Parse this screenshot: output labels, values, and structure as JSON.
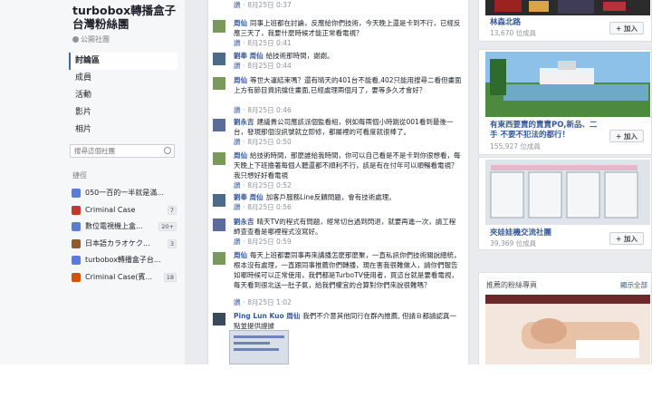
{
  "group": {
    "title": "turbobox轉播盒子台灣粉絲團",
    "type": "公開社團"
  },
  "nav": [
    "討論區",
    "成員",
    "活動",
    "影片",
    "相片"
  ],
  "search": {
    "placeholder": "搜尋這個社團"
  },
  "shortcuts": {
    "title": "捷徑",
    "items": [
      {
        "label": "050一百的一半就是滿...",
        "count": "",
        "color": "#5b7bd5"
      },
      {
        "label": "Criminal Case",
        "count": "7",
        "color": "#c0392b"
      },
      {
        "label": "數位電視機上盒...",
        "count": "20+",
        "color": "#5b7bd5"
      },
      {
        "label": "日本語カラオケク...",
        "count": "3",
        "color": "#8e5b2d"
      },
      {
        "label": "turbobox轉播盒子台...",
        "count": "",
        "color": "#5b7bd5"
      },
      {
        "label": "Criminal Case(賓...",
        "count": "18",
        "color": "#d35400"
      }
    ]
  },
  "comments": [
    {
      "name": "",
      "text": "",
      "time": "8月25日 0:37"
    },
    {
      "name": "周仙",
      "text": "同事上班都在討論，反應給你們技術，今天晚上還是卡到不行，已經反應三天了，我要什麼時候才能正常看電視？",
      "time": "8月25日 0:41"
    },
    {
      "name": "劉奉 周仙",
      "text": "給技術那時間，謝謝。",
      "time": "8月25日 0:44"
    },
    {
      "name": "周仙",
      "text": "等世大運結束嗎？還有晴天的401台不能看,402只能用搜尋二看但畫面上方有節目資訊擋住畫面,已經處理兩個月了，要等多久才會好？",
      "time": "8月25日 0:46"
    },
    {
      "name": "劉永吉",
      "text": "建議貴公司應該派個監看組，例如每兩個小時跳從001看到最後一台，發現那個沒訊號就立即修，都屬裡的可看度就很棒了。",
      "time": "8月25日 0:50"
    },
    {
      "name": "周仙",
      "text": "給技術時間，那麼誰給我時間，你可以自己看是不是卡到你很想看，每天晚上下班擔著每個人聽還都不順利不行，該是有在付年可以順暢看電視？我只想好好看電視",
      "time": "8月25日 0:52"
    },
    {
      "name": "劉奉 周仙",
      "text": "加客戶服務Line反饋問題，會有技術處理。",
      "time": "8月25日 0:56"
    },
    {
      "name": "劉永吉",
      "text": "晴天TV的程式有問題，經常切台過到閃退，就要再進一次，請工程師查查看是哪裡程式沒寫好。",
      "time": "8月25日 0:59"
    },
    {
      "name": "周仙",
      "text": "每天上班都要同事再來講播怎麼那麼聚，一直私訊你們技術關說總統，根本沒有處理，一直跟同事推薦你們轉播，現在害我很難做人，請你們報告如哪時候可以正常使用，我們都是TurboTV使用者，買這台就是要看電視，每天看到很北送一肚子氣，給我們權宜的合算對你們來說很難嗎？",
      "time": "8月25日 1:02"
    },
    {
      "name": "Ping Lun Kuo 周仙",
      "text": "我們不介意其他同行在群內推薦, 但請Ｂ都請認真一點並提供證據",
      "time": ""
    }
  ],
  "comment_actions": {
    "like": "讚"
  },
  "suggested": [
    {
      "name": "林森北路",
      "members": "13,670 位成員",
      "join": "+ 加入"
    },
    {
      "name": "有東西要賣的賣賣PO,新品、二手 不要不犯法的都行！",
      "members": "155,927 位成員",
      "join": "+ 加入"
    },
    {
      "name": "夾娃娃機交流社團",
      "members": "39,369 位成員",
      "join": "+ 加入"
    }
  ],
  "recommended": {
    "title": "推薦的粉絲專頁",
    "see_all": "顯示全部"
  }
}
